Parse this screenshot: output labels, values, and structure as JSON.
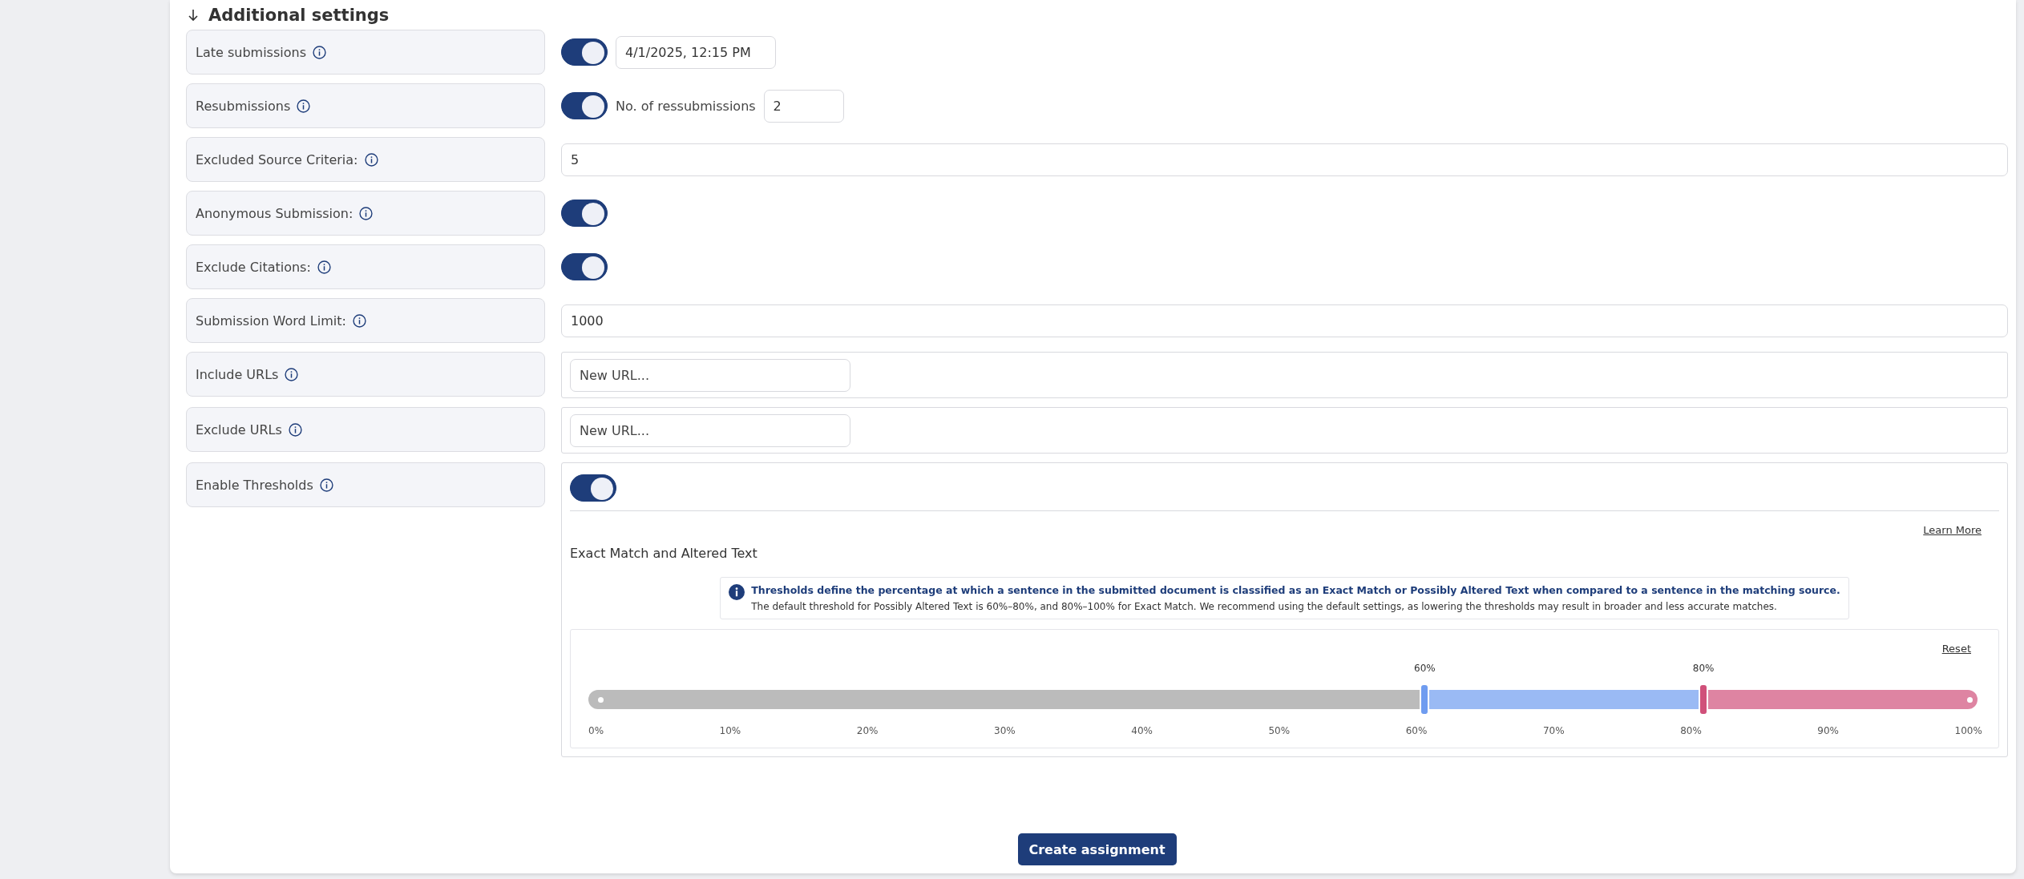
{
  "heading": {
    "label": "Additional settings",
    "expanded": true
  },
  "rows": [
    {
      "kind": "toggle_date",
      "label": "Late submissions",
      "on": true,
      "value": "4/1/2025, 12:15 PM"
    },
    {
      "kind": "toggle_count",
      "label": "Resubmissions",
      "on": true,
      "count_label": "No. of ressubmissions",
      "value": "2"
    },
    {
      "kind": "text",
      "label": "Excluded Source Criteria:",
      "value": "5"
    },
    {
      "kind": "toggle",
      "label": "Anonymous Submission:",
      "on": true
    },
    {
      "kind": "toggle",
      "label": "Exclude Citations:",
      "on": true
    },
    {
      "kind": "text",
      "label": "Submission Word Limit:",
      "value": "1000"
    },
    {
      "kind": "url",
      "label": "Include URLs",
      "placeholder": "New URL..."
    },
    {
      "kind": "url",
      "label": "Exclude URLs",
      "placeholder": "New URL..."
    },
    {
      "kind": "thresholds",
      "label": "Enable Thresholds",
      "on": true
    }
  ],
  "thresholds": {
    "learn_more": "Learn More",
    "title": "Exact Match and Altered Text",
    "info_title": "Thresholds define the percentage at which a sentence in the submitted document is classified as an Exact Match or Possibly Altered Text when compared to a sentence in the matching source.",
    "info_body": "The default threshold for Possibly Altered Text is 60%–80%, and 80%–100% for Exact Match. We recommend using the default settings, as lowering the thresholds may result in broader and less accurate matches.",
    "reset": "Reset",
    "handles": [
      {
        "label": "60%",
        "level": 0.6,
        "color": "#6f9cf0"
      },
      {
        "label": "80%",
        "level": 0.8,
        "color": "#d0507a"
      }
    ],
    "ticks": [
      "0%",
      "10%",
      "20%",
      "30%",
      "40%",
      "50%",
      "60%",
      "70%",
      "80%",
      "90%",
      "100%"
    ]
  },
  "submit": "Create assignment"
}
